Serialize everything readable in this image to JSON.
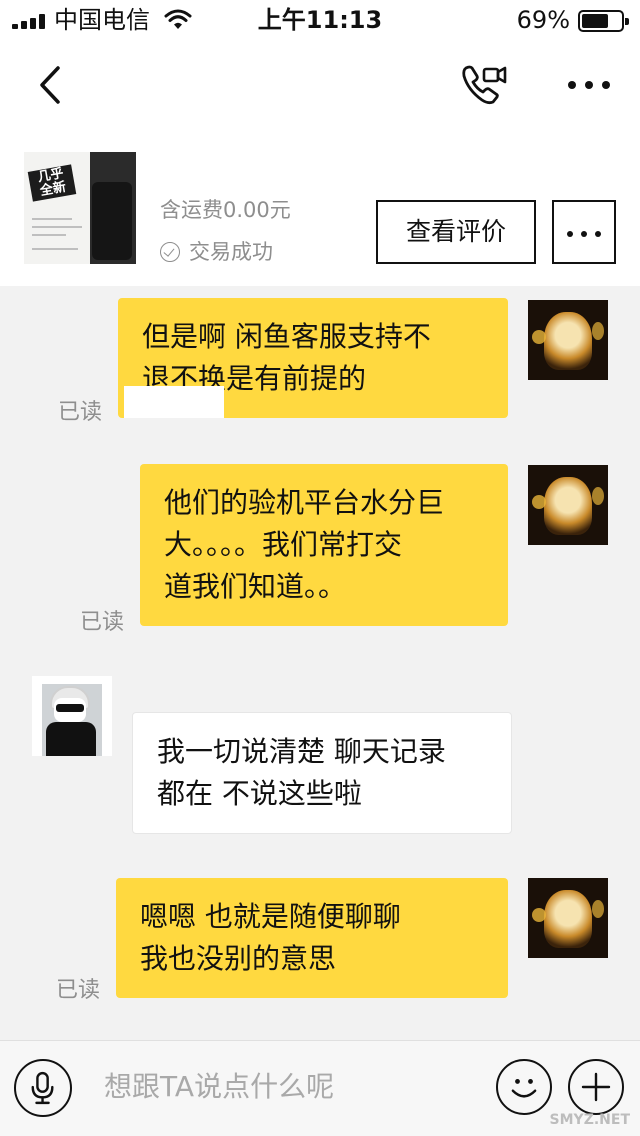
{
  "status_bar": {
    "carrier": "中国电信",
    "time": "上午11:13",
    "battery": "69%",
    "battery_level": 0.69
  },
  "nav": {
    "back_icon": "chevron-left-icon",
    "call_icon": "phone-video-icon",
    "more_icon": "more-horizontal-icon"
  },
  "product": {
    "thumb_badge_line1": "几乎",
    "thumb_badge_line2": "全新",
    "price": "含运费0.00元",
    "status": "交易成功",
    "review_button": "查看评价",
    "more_icon": "more-horizontal-icon"
  },
  "messages": [
    {
      "side": "mine",
      "lines": [
        "但是啊  闲鱼客服支持不",
        "退不换是有前提的"
      ],
      "read": "已读"
    },
    {
      "side": "mine",
      "lines": [
        "他们的验机平台水分巨",
        "大。。。。我们常打交",
        "道我们知道。。"
      ],
      "read": "已读"
    },
    {
      "side": "theirs",
      "lines": [
        "我一切说清楚 聊天记录",
        "都在 不说这些啦"
      ]
    },
    {
      "side": "mine",
      "lines": [
        "嗯嗯    也就是随便聊聊",
        "我也没别的意思"
      ],
      "read": "已读"
    }
  ],
  "input": {
    "placeholder": "想跟TA说点什么呢",
    "mic_icon": "microphone-icon",
    "emoji_icon": "smile-icon",
    "plus_icon": "plus-icon"
  },
  "watermark": "SMYZ.NET"
}
